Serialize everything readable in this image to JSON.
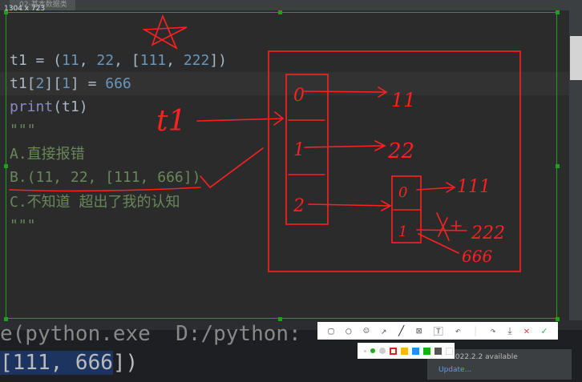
{
  "tab": {
    "filename": "02-基本数据类型.py"
  },
  "capture_size": "1304 x 723",
  "code": {
    "lines": [
      "t1 = (11, 22, [111, 222])",
      "t1[2][1] = 666",
      "print(t1)",
      "\"\"\"",
      "A.直接报错",
      "B.(11, 22, [111, 666])",
      "C.不知道 超出了我的认知",
      "\"\"\""
    ]
  },
  "annotations": {
    "labels": [
      "t1",
      "0",
      "1",
      "2",
      "11",
      "22",
      "0",
      "1",
      "111",
      "222",
      "666"
    ],
    "color": "#ff2020"
  },
  "terminal": {
    "line1": "e(python.exe  D:/python:",
    "line2_selected": "[111, 666",
    "line2_rest": "])"
  },
  "notice": {
    "text": "rm 2022.2.2 available",
    "link": "Update..."
  },
  "toolbar": {
    "tools": [
      "rectangle",
      "ellipse",
      "mosaic",
      "arrow",
      "pen",
      "blur",
      "text",
      "undo",
      "share",
      "save",
      "cancel",
      "confirm"
    ]
  },
  "palette": {
    "colors": [
      "#e02020",
      "#ffb800",
      "#1e90ff",
      "#1aad19",
      "#555555",
      "#ffffff"
    ],
    "selected": "#e02020"
  },
  "selection_color": "#1fa01f"
}
